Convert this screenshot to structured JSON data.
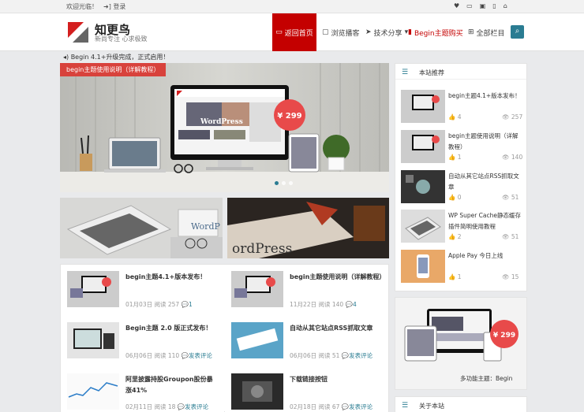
{
  "topbar": {
    "welcome": "欢迎光临！",
    "login": "登录"
  },
  "header": {
    "site_name": "知更鸟",
    "site_desc": "新尚专注 心求极致",
    "nav": [
      {
        "label": "返回首页",
        "icon": "monitor-icon"
      },
      {
        "label": "浏览播客",
        "icon": "page-icon"
      },
      {
        "label": "技术分享",
        "icon": "paper-plane-icon"
      },
      {
        "label": "Begin主题购买",
        "icon": "bookmark-icon"
      },
      {
        "label": "全部栏目",
        "icon": "sitemap-icon"
      }
    ]
  },
  "notice": "Begin 4.1+升级完成，正式启用！",
  "slider": {
    "tag": "begin主题使用说明（详解教程）",
    "price": "¥ 299",
    "brand": "WordPress"
  },
  "thumbs": {
    "right_text": "ordPress",
    "left_text": "WordP"
  },
  "posts": [
    {
      "title": "begin主题4.1+版本发布！",
      "date": "01月03日",
      "read_label": "阅读",
      "reads": "257",
      "comments": "1"
    },
    {
      "title": "begin主题使用说明（详解教程）",
      "date": "11月22日",
      "read_label": "阅读",
      "reads": "140",
      "comments": "4"
    },
    {
      "title": "Begin主题 2.0 版正式发布！",
      "date": "06月06日",
      "read_label": "阅读",
      "reads": "110",
      "comments": "发表评论"
    },
    {
      "title": "自动从其它站点RSS抓取文章",
      "date": "06月06日",
      "read_label": "阅读",
      "reads": "51",
      "comments": "发表评论"
    },
    {
      "title": "阿里披露持股Groupon股份暴涨41%",
      "date": "02月11日",
      "read_label": "阅读",
      "reads": "18",
      "comments": "发表评论"
    },
    {
      "title": "下载链接按钮",
      "date": "02月18日",
      "read_label": "阅读",
      "reads": "67",
      "comments": "发表评论"
    }
  ],
  "sidebar": {
    "recommend_title": "本站推荐",
    "items": [
      {
        "title": "begin主题4.1+版本发布！",
        "likes": "4",
        "views": "257"
      },
      {
        "title": "begin主题使用说明（详解教程）",
        "likes": "1",
        "views": "140"
      },
      {
        "title": "自动从其它站点RSS抓取文章",
        "likes": "0",
        "views": "51"
      },
      {
        "title": "WP Super Cache静态缓存插件简明使用教程",
        "likes": "2",
        "views": "51"
      },
      {
        "title": "Apple Pay 今日上线",
        "likes": "1",
        "views": "15"
      }
    ],
    "ad": {
      "price": "¥ 299",
      "caption": "多功能主题：Begin"
    },
    "about_title": "关于本站"
  },
  "colors": {
    "accent": "#2a7c92",
    "brand_red": "#c40000",
    "tag_red": "#d8423c"
  }
}
